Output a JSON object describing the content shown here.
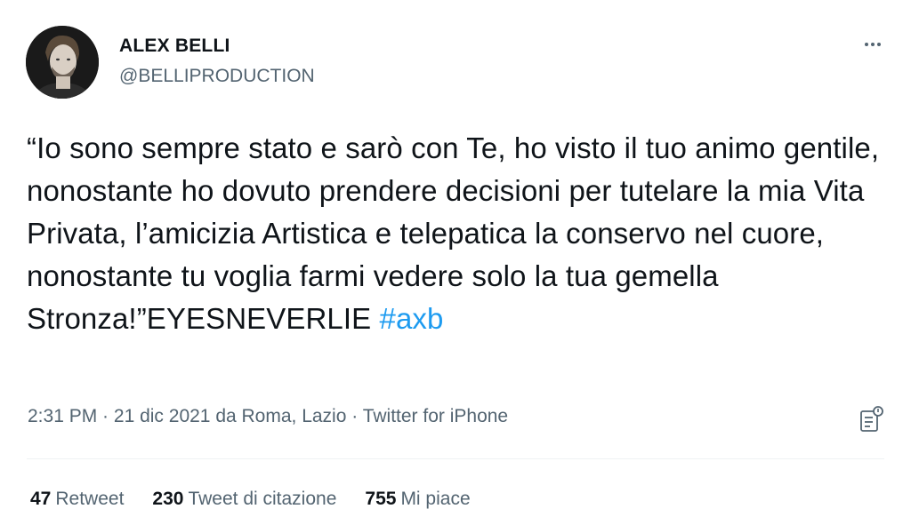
{
  "author": {
    "name": "ALEX BELLI",
    "handle": "@BELLIPRODUCTION"
  },
  "tweet": {
    "text": "“Io sono sempre stato e sarò con Te, ho visto il tuo animo gentile, nonostante ho dovuto prendere decisioni per tutelare la mia Vita Privata, l’amicizia Artistica e telepatica la conservo nel cuore, nonostante tu voglia farmi vedere solo la tua gemella Stronza!”EYESNEVERLIE ",
    "hashtag": "#axb"
  },
  "meta": {
    "time": "2:31 PM",
    "separator1": " · ",
    "date_location": "21 dic 2021 da Roma, Lazio",
    "separator2": " · ",
    "source": "Twitter for iPhone"
  },
  "stats": {
    "retweets_count": "47",
    "retweets_label": "Retweet",
    "quotes_count": "230",
    "quotes_label": "Tweet di citazione",
    "likes_count": "755",
    "likes_label": "Mi piace"
  },
  "icons": {
    "more": "more-dots-icon",
    "analytics": "analytics-icon"
  },
  "colors": {
    "hashtag": "#1d9bf0",
    "secondary_text": "#536471",
    "primary_text": "#0f1419"
  }
}
